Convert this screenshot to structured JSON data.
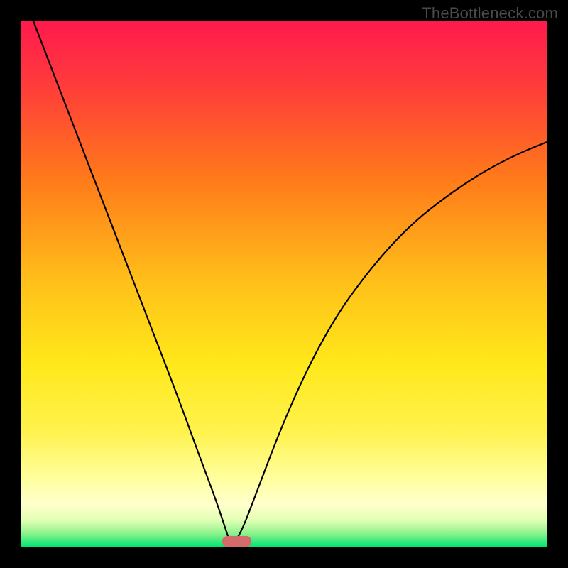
{
  "watermark": "TheBottleneck.com",
  "colors": {
    "frame": "#000000",
    "marker": "#d46a6a",
    "curve": "#000000"
  },
  "gradient_stops": [
    {
      "offset": 0.0,
      "color": "#ff1a4d"
    },
    {
      "offset": 0.12,
      "color": "#ff3b3b"
    },
    {
      "offset": 0.3,
      "color": "#ff7a1a"
    },
    {
      "offset": 0.5,
      "color": "#ffc11a"
    },
    {
      "offset": 0.65,
      "color": "#ffe81a"
    },
    {
      "offset": 0.78,
      "color": "#fff24d"
    },
    {
      "offset": 0.87,
      "color": "#ffff9e"
    },
    {
      "offset": 0.92,
      "color": "#ffffcc"
    },
    {
      "offset": 0.95,
      "color": "#e1ffb3"
    },
    {
      "offset": 0.975,
      "color": "#8cf28c"
    },
    {
      "offset": 1.0,
      "color": "#00e673"
    }
  ],
  "chart_data": {
    "type": "line",
    "title": "",
    "xlabel": "",
    "ylabel": "",
    "xrange": [
      0,
      1
    ],
    "yrange": [
      0,
      1
    ],
    "description": "Two-branch bottleneck curve. Left branch descends steeply from top-left to a minimum near x≈0.40 at y≈0; right branch rises from the same minimum toward the right edge, reaching y≈0.77 at x=1. Lower y (closer to green) indicates better balance.",
    "minimum_x": 0.4,
    "marker": {
      "x_center": 0.41,
      "width_frac": 0.055
    },
    "series": [
      {
        "name": "left-branch",
        "x": [
          0.0,
          0.05,
          0.1,
          0.15,
          0.2,
          0.25,
          0.3,
          0.34,
          0.37,
          0.39,
          0.4
        ],
        "y": [
          1.06,
          0.93,
          0.8,
          0.67,
          0.54,
          0.41,
          0.28,
          0.17,
          0.09,
          0.03,
          0.0
        ]
      },
      {
        "name": "right-branch",
        "x": [
          0.4,
          0.42,
          0.45,
          0.5,
          0.55,
          0.6,
          0.65,
          0.7,
          0.75,
          0.8,
          0.85,
          0.9,
          0.95,
          1.0
        ],
        "y": [
          0.0,
          0.03,
          0.11,
          0.24,
          0.35,
          0.44,
          0.51,
          0.57,
          0.62,
          0.66,
          0.695,
          0.725,
          0.75,
          0.77
        ]
      }
    ]
  }
}
